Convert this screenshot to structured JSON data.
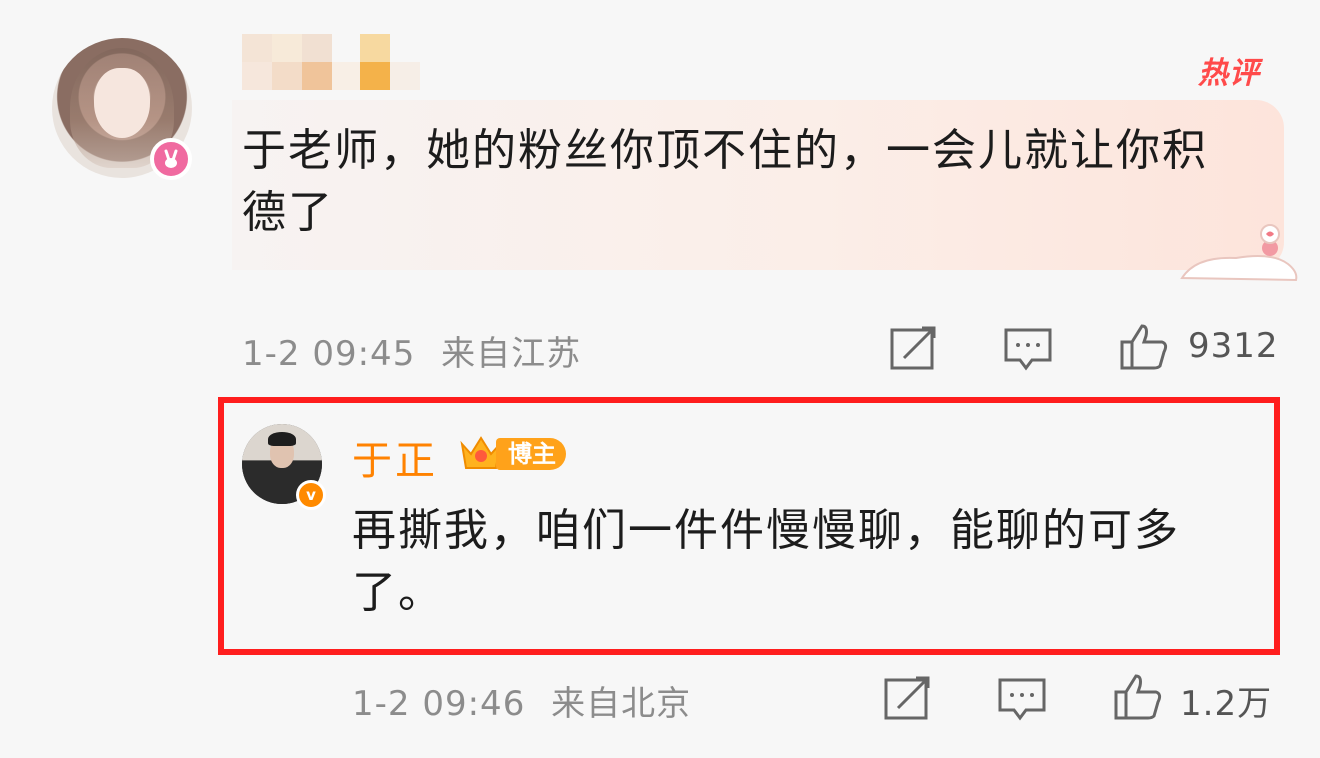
{
  "comment1": {
    "hot_label": "热评",
    "text": "于老师，她的粉丝你顶不住的，一会儿就让你积德了",
    "time": "1-2 09:45",
    "location": "来自江苏",
    "likes": "9312",
    "icons": [
      "share-icon",
      "comment-icon",
      "like-icon"
    ]
  },
  "comment2": {
    "author": "于正",
    "badge_label": "博主",
    "verified_mark": "v",
    "text": "再撕我，咱们一件件慢慢聊，能聊的可多了。",
    "time": "1-2 09:46",
    "location": "来自北京",
    "likes": "1.2万",
    "icons": [
      "share-icon",
      "comment-icon",
      "like-icon"
    ]
  },
  "colors": {
    "highlight_border": "#ff1e1e",
    "author_name": "#ff8200",
    "hot_label": "#ff4a4a",
    "meta_text": "#8c8c8c"
  }
}
